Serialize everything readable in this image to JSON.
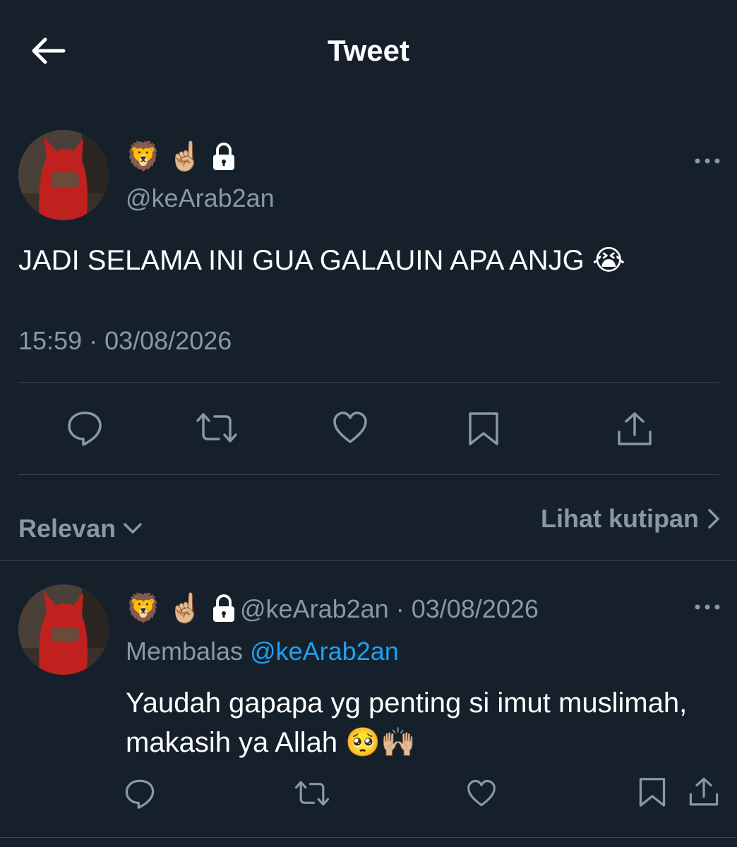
{
  "header": {
    "title": "Tweet"
  },
  "tweet": {
    "display_name_emoji": [
      "🦁",
      "☝🏼"
    ],
    "handle": "@keArab2an",
    "text": "JADI SELAMA INI GUA GALAUIN APA ANJG 😭",
    "timestamp": "15:59 · 03/08/2026"
  },
  "sort": {
    "label": "Relevan"
  },
  "quotes_link": {
    "label": "Lihat kutipan"
  },
  "reply": {
    "display_name_emoji": [
      "🦁",
      "☝🏼"
    ],
    "handle": "@keArab2an",
    "separator": "·",
    "date": "03/08/2026",
    "replying_prefix": "Membalas",
    "replying_to": "@keArab2an",
    "text_line1": "Yaudah gapapa yg penting si imut muslimah,",
    "text_line2": "makasih ya Allah 🥺🙌🏼"
  },
  "colors": {
    "background": "#15202b",
    "secondary_text": "#8899a6",
    "link": "#1da1f2",
    "divider": "#38444d"
  },
  "icons": [
    "back-arrow-icon",
    "lock-icon",
    "more-icon",
    "reply-icon",
    "retweet-icon",
    "like-icon",
    "bookmark-icon",
    "share-icon",
    "chevron-down-icon",
    "chevron-right-icon"
  ]
}
